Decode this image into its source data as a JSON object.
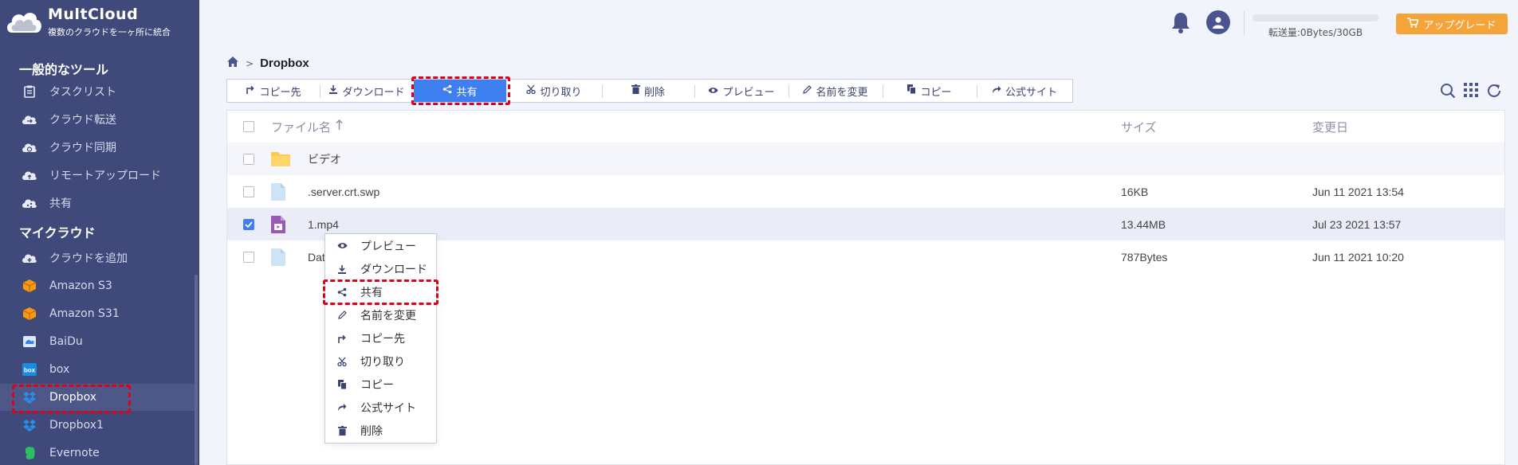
{
  "brand": {
    "name": "MultCloud",
    "tagline": "複数のクラウドを一ヶ所に統合"
  },
  "sidebar": {
    "tools_title": "一般的なツール",
    "tools": [
      {
        "label": "タスクリスト",
        "icon": "task-list-icon"
      },
      {
        "label": "クラウド転送",
        "icon": "cloud-transfer-icon"
      },
      {
        "label": "クラウド同期",
        "icon": "cloud-sync-icon"
      },
      {
        "label": "リモートアップロード",
        "icon": "remote-upload-icon"
      },
      {
        "label": "共有",
        "icon": "share-cloud-icon"
      }
    ],
    "clouds_title": "マイクラウド",
    "clouds": [
      {
        "label": "クラウドを追加",
        "icon": "add-cloud-icon"
      },
      {
        "label": "Amazon S3",
        "icon": "amazon-s3-icon"
      },
      {
        "label": "Amazon S31",
        "icon": "amazon-s3-icon"
      },
      {
        "label": "BaiDu",
        "icon": "baidu-icon"
      },
      {
        "label": "box",
        "icon": "box-icon"
      },
      {
        "label": "Dropbox",
        "icon": "dropbox-icon"
      },
      {
        "label": "Dropbox1",
        "icon": "dropbox-icon"
      },
      {
        "label": "Evernote",
        "icon": "evernote-icon"
      }
    ]
  },
  "header": {
    "quota_text": "転送量:0Bytes/30GB",
    "quota_used_fraction": 0,
    "upgrade_label": "アップグレード"
  },
  "breadcrumb": {
    "current": "Dropbox"
  },
  "toolbar": [
    {
      "label": "コピー先",
      "icon": "copy-to-icon"
    },
    {
      "label": "ダウンロード",
      "icon": "download-icon"
    },
    {
      "label": "共有",
      "icon": "share-icon"
    },
    {
      "label": "切り取り",
      "icon": "cut-icon"
    },
    {
      "label": "削除",
      "icon": "delete-icon"
    },
    {
      "label": "プレビュー",
      "icon": "preview-icon"
    },
    {
      "label": "名前を変更",
      "icon": "rename-icon"
    },
    {
      "label": "コピー",
      "icon": "copy-icon"
    },
    {
      "label": "公式サイト",
      "icon": "official-site-icon"
    }
  ],
  "table": {
    "columns": {
      "name": "ファイル名",
      "size": "サイズ",
      "date": "変更日"
    },
    "rows": [
      {
        "name": "ビデオ",
        "size": "",
        "date": "",
        "type": "folder",
        "checked": false
      },
      {
        "name": ".server.crt.swp",
        "size": "16KB",
        "date": "Jun 11 2021 13:54",
        "type": "file",
        "checked": false
      },
      {
        "name": "1.mp4",
        "size": "13.44MB",
        "date": "Jul 23 2021 13:57",
        "type": "video",
        "checked": true
      },
      {
        "name": "Dat",
        "size": "787Bytes",
        "date": "Jun 11 2021 10:20",
        "type": "file",
        "checked": false
      }
    ]
  },
  "context_menu": [
    {
      "label": "プレビュー",
      "icon": "preview-icon"
    },
    {
      "label": "ダウンロード",
      "icon": "download-icon"
    },
    {
      "label": "共有",
      "icon": "share-icon"
    },
    {
      "label": "名前を変更",
      "icon": "rename-icon"
    },
    {
      "label": "コピー先",
      "icon": "copy-to-icon"
    },
    {
      "label": "切り取り",
      "icon": "cut-icon"
    },
    {
      "label": "コピー",
      "icon": "copy-icon"
    },
    {
      "label": "公式サイト",
      "icon": "official-site-icon"
    },
    {
      "label": "削除",
      "icon": "delete-icon"
    }
  ],
  "colors": {
    "sidebar_bg": "#3f4a7a",
    "accent": "#3e7ff0",
    "upgrade": "#f5a43a",
    "highlight": "#e0001a"
  }
}
